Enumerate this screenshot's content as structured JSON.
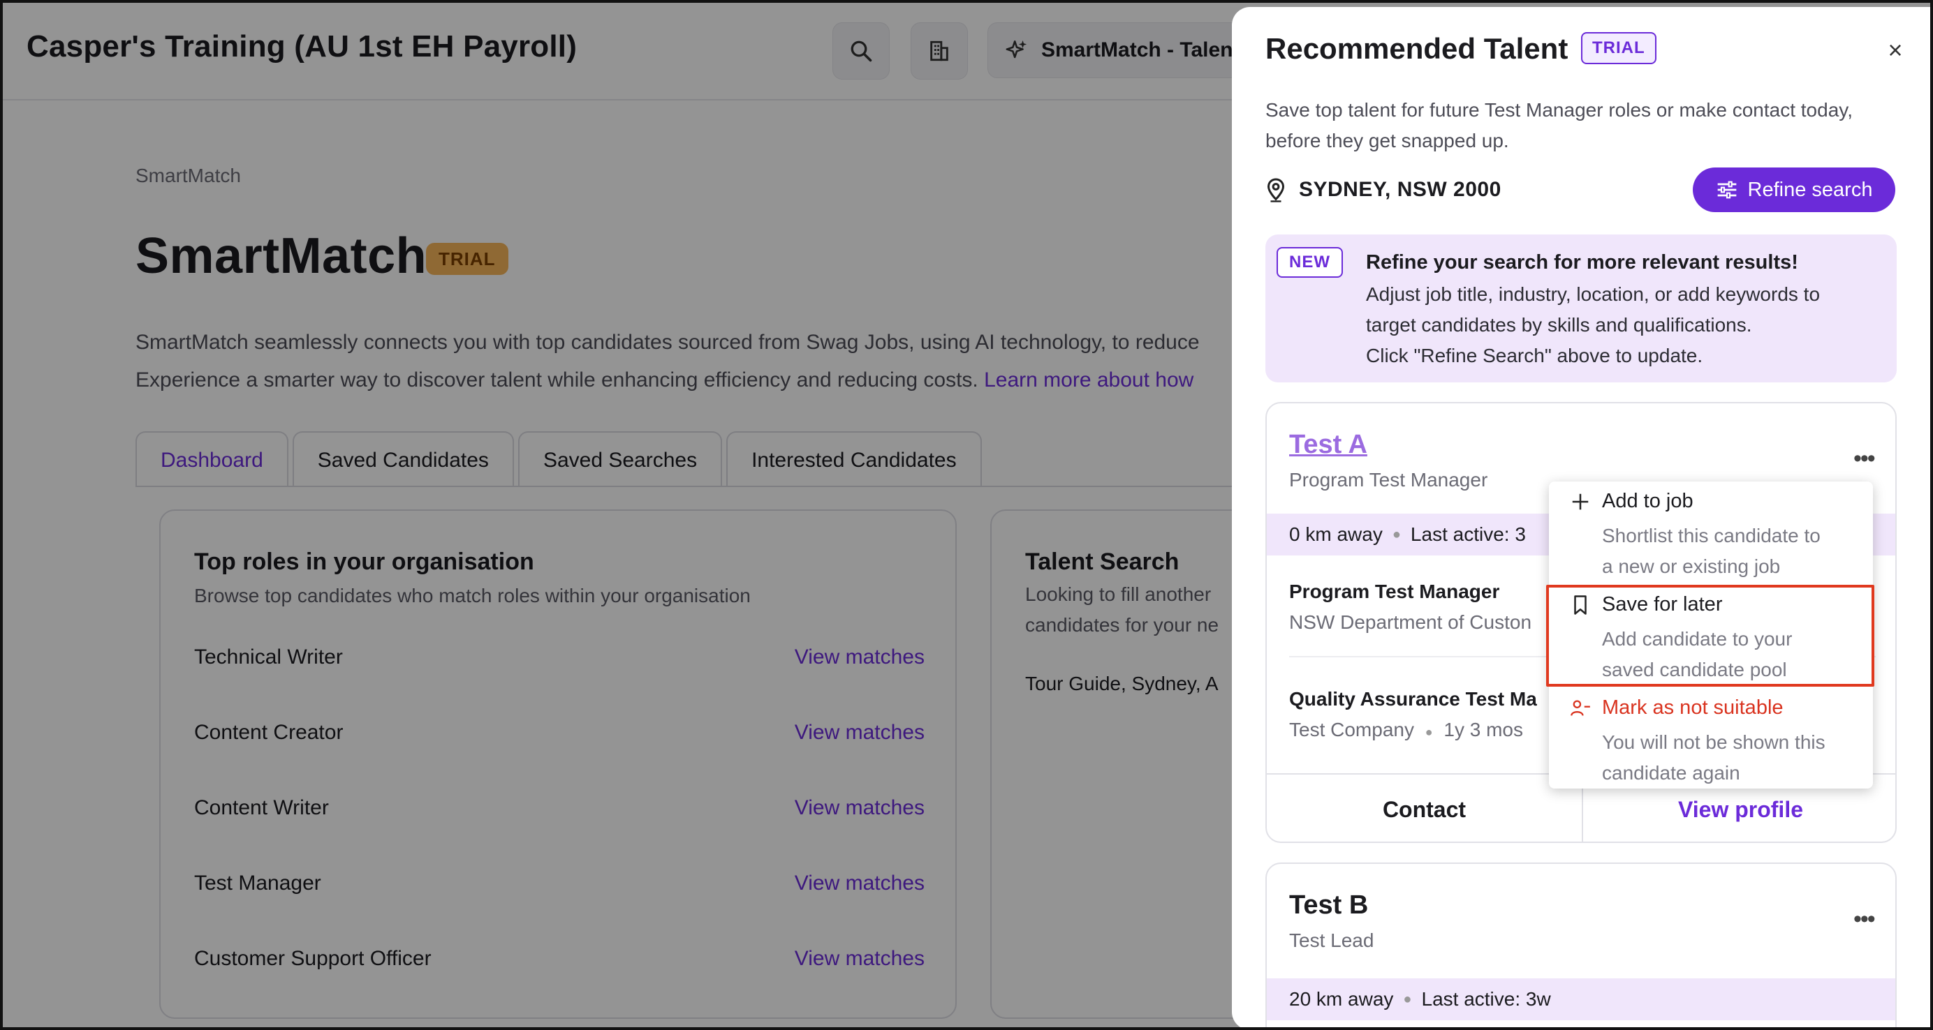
{
  "header": {
    "org_title": "Casper's Training (AU 1st EH Payroll)",
    "search_icon": "search-icon",
    "building_icon": "building-icon",
    "smartmatch_button": "SmartMatch - Talen"
  },
  "page": {
    "breadcrumb": "SmartMatch",
    "title": "SmartMatch",
    "trial_badge": "TRIAL",
    "intro_line1": "SmartMatch seamlessly connects you with top candidates sourced from Swag Jobs, using AI technology, to reduce",
    "intro_line2": "Experience a smarter way to discover talent while enhancing efficiency and reducing costs.",
    "intro_link": "Learn more about how",
    "tabs": [
      "Dashboard",
      "Saved Candidates",
      "Saved Searches",
      "Interested Candidates"
    ]
  },
  "roles_card": {
    "title": "Top roles in your organisation",
    "subtitle": "Browse top candidates who match roles within your organisation",
    "action_label": "View matches",
    "roles": [
      "Technical Writer",
      "Content Creator",
      "Content Writer",
      "Test Manager",
      "Customer Support Officer"
    ]
  },
  "talent_card": {
    "title": "Talent Search",
    "subtitle_line1": "Looking to fill another",
    "subtitle_line2": "candidates for your ne",
    "item": "Tour Guide, Sydney, A"
  },
  "panel": {
    "title": "Recommended Talent",
    "trial_badge": "TRIAL",
    "close": "×",
    "description": "Save top talent for future Test Manager roles or make contact today, before they get snapped up.",
    "location": "SYDNEY, NSW 2000",
    "refine_button": "Refine search",
    "new_box": {
      "badge": "NEW",
      "title": "Refine your search for more relevant results!",
      "line1": "Adjust job title, industry, location, or add keywords to",
      "line2": "target candidates by skills and qualifications.",
      "line3": "Click \"Refine Search\" above to update."
    }
  },
  "candidates": [
    {
      "name": "Test A",
      "role": "Program Test Manager",
      "distance": "0 km away",
      "last_active": "Last active: 3",
      "experience": [
        {
          "title": "Program Test Manager",
          "company": "NSW Department of Custon"
        },
        {
          "title": "Quality Assurance Test Ma",
          "company": "Test Company",
          "duration": "1y 3 mos"
        }
      ],
      "contact_label": "Contact",
      "view_label": "View profile"
    },
    {
      "name": "Test B",
      "role": "Test Lead",
      "distance": "20 km away",
      "last_active": "Last active: 3w"
    }
  ],
  "menu": {
    "items": [
      {
        "icon": "plus-icon",
        "title": "Add to job",
        "desc_line1": "Shortlist this candidate to",
        "desc_line2": "a new or existing job"
      },
      {
        "icon": "bookmark-icon",
        "title": "Save for later",
        "desc_line1": "Add candidate to your",
        "desc_line2": "saved candidate pool"
      },
      {
        "icon": "user-remove-icon",
        "title": "Mark as not suitable",
        "desc_line1": "You will not be shown this",
        "desc_line2": "candidate again"
      }
    ]
  },
  "colors": {
    "accent": "#6b2bd9",
    "danger": "#d9331f",
    "highlight": "#e0391f",
    "trial_orange": "#f6b55a"
  }
}
